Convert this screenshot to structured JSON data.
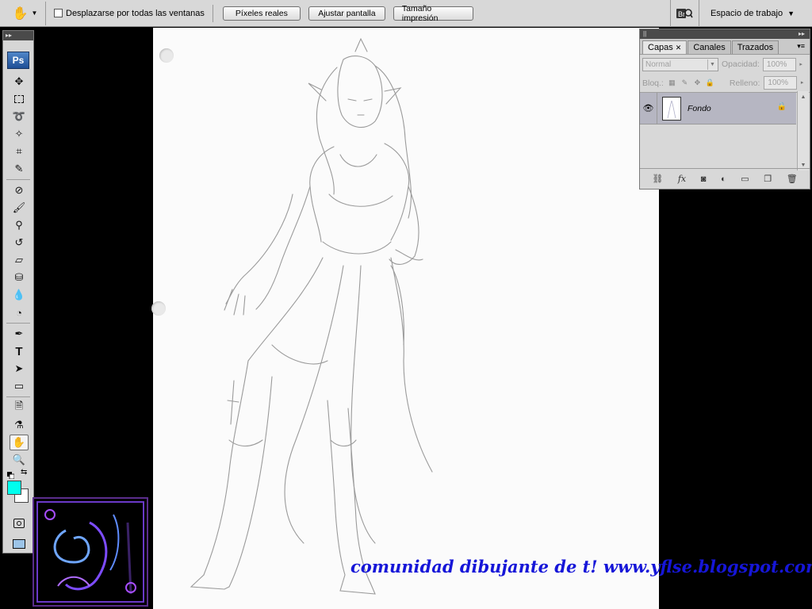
{
  "options_bar": {
    "tool_icon": "hand-icon",
    "scroll_all_label": "Desplazarse por todas las ventanas",
    "scroll_all_checked": false,
    "buttons": [
      "Píxeles reales",
      "Ajustar pantalla",
      "Tamaño impresión"
    ],
    "bridge_icon": "bridge-icon",
    "workspace_label": "Espacio de trabajo"
  },
  "tools_panel": {
    "logo": "Ps",
    "selected_tool": "hand",
    "foreground_color": "#00ffee",
    "background_color": "#ffffff"
  },
  "layers_panel": {
    "tabs": [
      "Capas",
      "Canales",
      "Trazados"
    ],
    "active_tab": "Capas",
    "blend_mode": "Normal",
    "opacity_label": "Opacidad:",
    "opacity_value": "100%",
    "lock_label": "Bloq.:",
    "fill_label": "Relleno:",
    "fill_value": "100%",
    "layers": [
      {
        "name": "Fondo",
        "visible": true,
        "locked": true
      }
    ]
  },
  "watermark": "comunidad dibujante de t! www.yflse.blogspot.com"
}
